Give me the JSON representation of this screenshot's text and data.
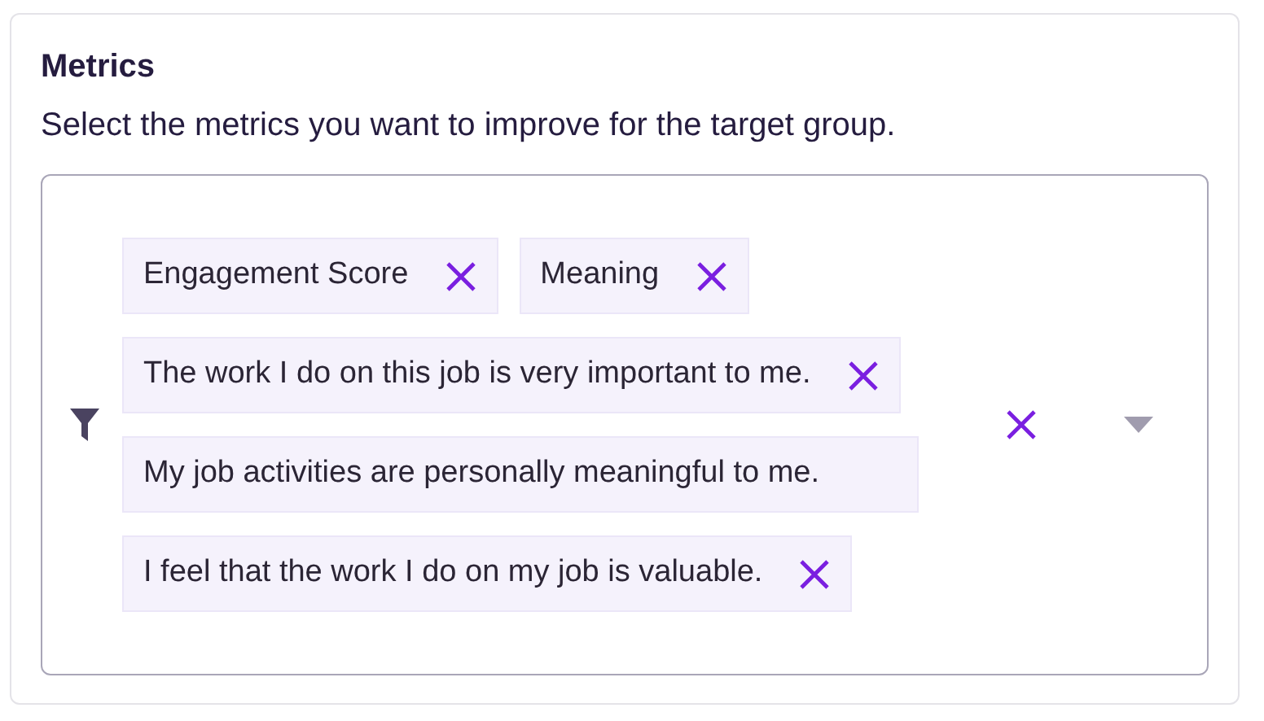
{
  "section": {
    "title": "Metrics",
    "description": "Select the metrics you want to improve for the target group."
  },
  "select": {
    "tags": [
      {
        "label": "Engagement Score",
        "remove_icon": true
      },
      {
        "label": "Meaning",
        "remove_icon": true
      },
      {
        "label": "The work I do on this job is very important to me.",
        "remove_icon": true
      },
      {
        "label": "My job activities are personally meaningful to me.",
        "remove_icon": false
      },
      {
        "label": "I feel that the work I do on my job is valuable.",
        "remove_icon": true
      }
    ]
  }
}
